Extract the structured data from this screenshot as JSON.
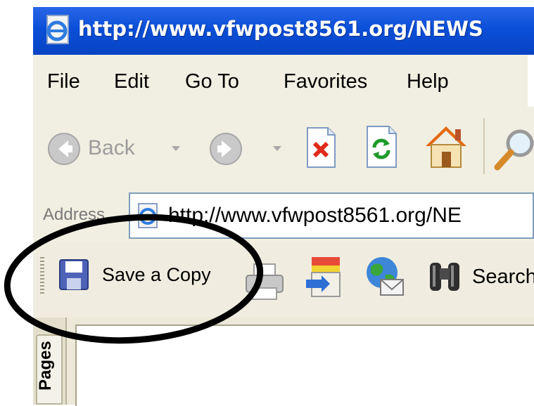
{
  "window": {
    "title": "http://www.vfwpost8561.org/NEWS"
  },
  "menu": {
    "items": [
      "File",
      "Edit",
      "Go To",
      "Favorites",
      "Help"
    ]
  },
  "toolbar": {
    "back_label": "Back"
  },
  "address": {
    "label": "Address",
    "url": "http://www.vfwpost8561.org/NE"
  },
  "pdf_toolbar": {
    "save_label": "Save a Copy",
    "search_label": "Search"
  },
  "side_tab": {
    "label": "Pages"
  },
  "colors": {
    "titlebar": "#0a4fd8",
    "chrome": "#f1efe2",
    "highlight_ellipse": "#000000"
  },
  "icons": [
    "ie-page-icon",
    "back-arrow-icon",
    "forward-arrow-icon",
    "dropdown-arrow-icon",
    "stop-icon",
    "refresh-icon",
    "home-icon",
    "search-magnifier-icon",
    "floppy-disk-icon",
    "printer-icon",
    "email-page-icon",
    "globe-mail-icon",
    "binoculars-icon"
  ]
}
